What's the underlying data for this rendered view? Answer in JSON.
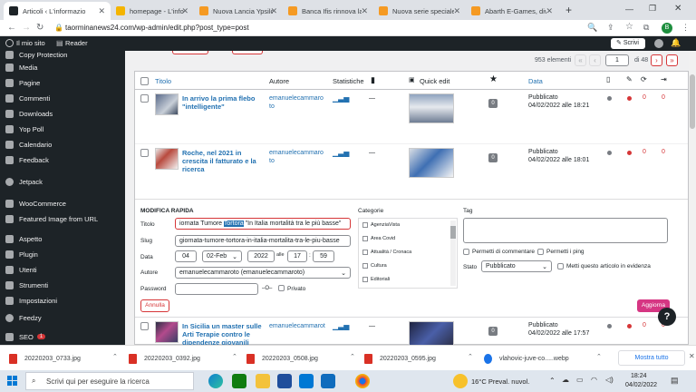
{
  "browser": {
    "tabs": [
      {
        "label": "Articoli ‹ L'informazio",
        "active": true,
        "color": "#1d2327"
      },
      {
        "label": "homepage - L'informaz",
        "active": false,
        "color": "#f4b400"
      },
      {
        "label": "Nuova Lancia Ypsilon",
        "active": false,
        "color": "#f59a23"
      },
      {
        "label": "Banca Ifis rinnova la f",
        "active": false,
        "color": "#f59a23"
      },
      {
        "label": "Nuova serie speciale",
        "active": false,
        "color": "#f59a23"
      },
      {
        "label": "Abarth E-Games, dive",
        "active": false,
        "color": "#f59a23"
      }
    ],
    "new_tab": "+",
    "url": "taorminanews24.com/wp-admin/edit.php?post_type=post",
    "profile_initial": "B"
  },
  "adminbar": {
    "site": "Il mio sito",
    "reader": "Reader",
    "write": "Scrivi"
  },
  "sidebar": {
    "items": [
      {
        "label": "Copy Protection",
        "icon": "lock-icon"
      },
      {
        "label": "Media",
        "icon": "media-icon"
      },
      {
        "label": "Pagine",
        "icon": "page-icon"
      },
      {
        "label": "Commenti",
        "icon": "comment-icon"
      },
      {
        "label": "Downloads",
        "icon": "download-icon"
      },
      {
        "label": "Yop Poll",
        "icon": "poll-icon"
      },
      {
        "label": "Calendario",
        "icon": "calendar-icon"
      },
      {
        "label": "Feedback",
        "icon": "feedback-icon"
      },
      {
        "label": "Jetpack",
        "icon": "jetpack-icon"
      },
      {
        "label": "WooCommerce",
        "icon": "woocommerce-icon"
      },
      {
        "label": "Featured Image from URL",
        "icon": "image-url-icon"
      },
      {
        "label": "Aspetto",
        "icon": "brush-icon"
      },
      {
        "label": "Plugin",
        "icon": "plugin-icon"
      },
      {
        "label": "Utenti",
        "icon": "users-icon"
      },
      {
        "label": "Strumenti",
        "icon": "tools-icon"
      },
      {
        "label": "Impostazioni",
        "icon": "settings-icon"
      },
      {
        "label": "Feedzy",
        "icon": "feedzy-icon"
      },
      {
        "label": "SEO",
        "icon": "seo-icon",
        "badge": "1"
      }
    ]
  },
  "pagination": {
    "count": "953 elementi",
    "first": "«",
    "prev": "‹",
    "page": "1",
    "of": "di 48",
    "next": "›",
    "last": "»"
  },
  "table": {
    "headers": {
      "title": "Titolo",
      "author": "Autore",
      "stats": "Statistiche",
      "quick_edit": "Quick edit",
      "date": "Data"
    },
    "rows": [
      {
        "title": "In arrivo la prima flebo \"intelligente\"",
        "author": "emanuelecammaroto",
        "dash": "—",
        "comments": "0",
        "status": "Pubblicato",
        "date": "04/02/2022 alle 18:21",
        "zero1": "0",
        "zero2": "0"
      },
      {
        "title": "Roche, nel 2021 in crescita il fatturato e la ricerca",
        "author": "emanuelecammaroto",
        "dash": "—",
        "comments": "0",
        "status": "Pubblicato",
        "date": "04/02/2022 alle 18:01",
        "zero1": "0",
        "zero2": "0"
      },
      {
        "title": "In Sicilia un master sulle Arti Terapie contro le dipendenze giovanili",
        "author": "emanuelecammarot",
        "dash": "—",
        "comments": "0",
        "status": "Pubblicato",
        "date": "04/02/2022 alle 17:57",
        "zero1": "0",
        "zero2": "0"
      }
    ]
  },
  "quickedit": {
    "heading": "MODIFICA RAPIDA",
    "title_label": "Titolo",
    "title_before": "iornata Tumore ",
    "title_selected": "Tortora",
    "title_after": " \"In Italia mortalità tra le più basse\"",
    "slug_label": "Slug",
    "slug_value": "giornata-tumore-tortora-in-italia-mortalita-tra-le-piu-basse",
    "date_label": "Data",
    "day": "04",
    "month": "02-Feb",
    "year": "2022",
    "at": "alle",
    "hour": "17",
    "minute": "59",
    "author_label": "Autore",
    "author_value": "emanuelecammaroto (emanuelecammaroto)",
    "password_label": "Password",
    "or": "–O–",
    "private": "Privato",
    "categories_label": "Categorie",
    "categories": [
      "AgenziaVista",
      "Area Covid",
      "Attualità / Cronaca",
      "Cultura",
      "Editoriali"
    ],
    "tags_label": "Tag",
    "allow_comments": "Permetti di commentare",
    "allow_pings": "Permetti i ping",
    "state_label": "Stato",
    "state_value": "Pubblicato",
    "sticky": "Metti questo articolo in evidenza",
    "cancel": "Annulla",
    "update": "Aggiorna"
  },
  "downloads": {
    "files": [
      "20220203_0733.jpg",
      "20220203_0392.jpg",
      "20220203_0508.jpg",
      "20220203_0595.jpg",
      "vlahovic-juve-co.....webp"
    ],
    "show_all": "Mostra tutto"
  },
  "taskbar": {
    "search": "Scrivi qui per eseguire la ricerca",
    "weather": "16°C  Preval. nuvol.",
    "time": "18:24",
    "date": "04/02/2022"
  }
}
